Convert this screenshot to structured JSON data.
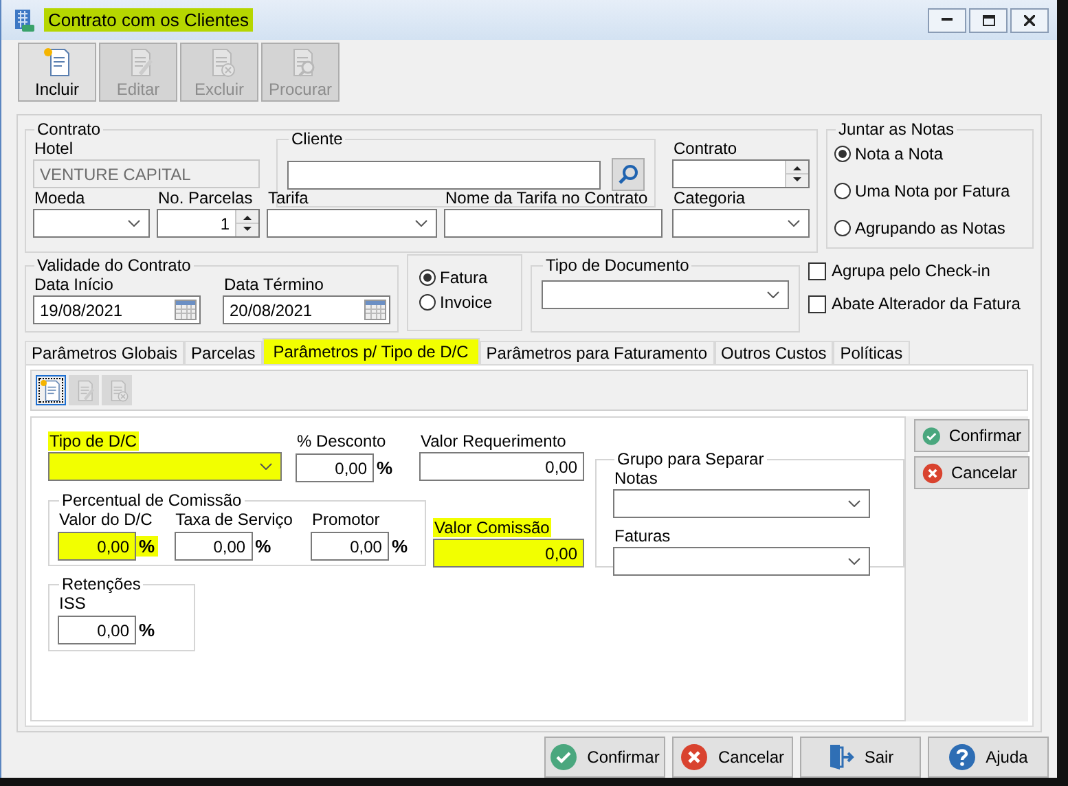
{
  "window": {
    "title": "Contrato com os Clientes",
    "highlighted": true
  },
  "toolbar": [
    {
      "label": "Incluir",
      "kind": "new",
      "disabled": false
    },
    {
      "label": "Editar",
      "kind": "edit",
      "disabled": true
    },
    {
      "label": "Excluir",
      "kind": "delete",
      "disabled": true
    },
    {
      "label": "Procurar",
      "kind": "search",
      "disabled": true
    }
  ],
  "contrato": {
    "legend": "Contrato",
    "hotel": {
      "label": "Hotel",
      "value": "VENTURE CAPITAL"
    },
    "cliente": {
      "legend": "Cliente"
    },
    "contrato": {
      "label": "Contrato"
    },
    "moeda": {
      "label": "Moeda"
    },
    "parcelas": {
      "label": "No. Parcelas",
      "value": "1"
    },
    "tarifa": {
      "label": "Tarifa"
    },
    "nome_tarifa": {
      "label": "Nome da Tarifa no Contrato"
    },
    "categoria": {
      "label": "Categoria"
    }
  },
  "juntar": {
    "legend": "Juntar as Notas",
    "options": [
      {
        "label": "Nota a Nota",
        "selected": true
      },
      {
        "label": "Uma Nota por Fatura",
        "selected": false
      },
      {
        "label": "Agrupando as Notas",
        "selected": false
      }
    ]
  },
  "validade": {
    "legend": "Validade do Contrato",
    "inicio": {
      "label": "Data Início",
      "value": "19/08/2021"
    },
    "termino": {
      "label": "Data Término",
      "value": "20/08/2021"
    }
  },
  "documento": [
    {
      "label": "Fatura",
      "selected": true
    },
    {
      "label": "Invoice",
      "selected": false
    }
  ],
  "tipo_documento": {
    "legend": "Tipo de Documento"
  },
  "checkboxes": [
    {
      "label": "Agrupa pelo Check-in",
      "checked": false
    },
    {
      "label": "Abate Alterador da Fatura",
      "checked": false
    }
  ],
  "tabs": [
    {
      "label": "Parâmetros Globais",
      "selected": false
    },
    {
      "label": "Parcelas",
      "selected": false
    },
    {
      "label": "Parâmetros p/ Tipo de D/C",
      "selected": true,
      "highlighted": true
    },
    {
      "label": "Parâmetros para Faturamento",
      "selected": false
    },
    {
      "label": "Outros Custos",
      "selected": false
    },
    {
      "label": "Políticas",
      "selected": false
    }
  ],
  "tab_toolbar": [
    {
      "kind": "new",
      "selected": true,
      "disabled": false
    },
    {
      "kind": "edit",
      "selected": false,
      "disabled": true
    },
    {
      "kind": "delete",
      "selected": false,
      "disabled": true
    }
  ],
  "dc": {
    "tipo": {
      "label": "Tipo de D/C",
      "highlighted": true
    },
    "desconto": {
      "label": "% Desconto",
      "value": "0,00",
      "unit": "%"
    },
    "requerimento": {
      "label": "Valor Requerimento",
      "value": "0,00"
    },
    "comissao": {
      "legend": "Percentual de Comissão",
      "fields": [
        {
          "label": "Valor do D/C",
          "value": "0,00",
          "unit": "%",
          "highlighted": true
        },
        {
          "label": "Taxa de Serviço",
          "value": "0,00",
          "unit": "%",
          "highlighted": false
        },
        {
          "label": "Promotor",
          "value": "0,00",
          "unit": "%",
          "highlighted": false
        }
      ]
    },
    "valor_comissao": {
      "label": "Valor Comissão",
      "value": "0,00",
      "highlighted": true
    },
    "retencoes": {
      "legend": "Retenções",
      "fields": [
        {
          "label": "ISS",
          "value": "0,00",
          "unit": "%",
          "highlighted": false
        }
      ]
    },
    "grupo": {
      "legend": "Grupo para Separar",
      "fields": [
        {
          "label": "Notas"
        },
        {
          "label": "Faturas"
        }
      ]
    }
  },
  "side_buttons": [
    {
      "label": "Confirmar",
      "kind": "confirm"
    },
    {
      "label": "Cancelar",
      "kind": "cancel"
    }
  ],
  "footer_buttons": [
    {
      "label": "Confirmar",
      "kind": "confirm"
    },
    {
      "label": "Cancelar",
      "kind": "cancel"
    },
    {
      "label": "Sair",
      "kind": "exit"
    },
    {
      "label": "Ajuda",
      "kind": "help"
    }
  ]
}
